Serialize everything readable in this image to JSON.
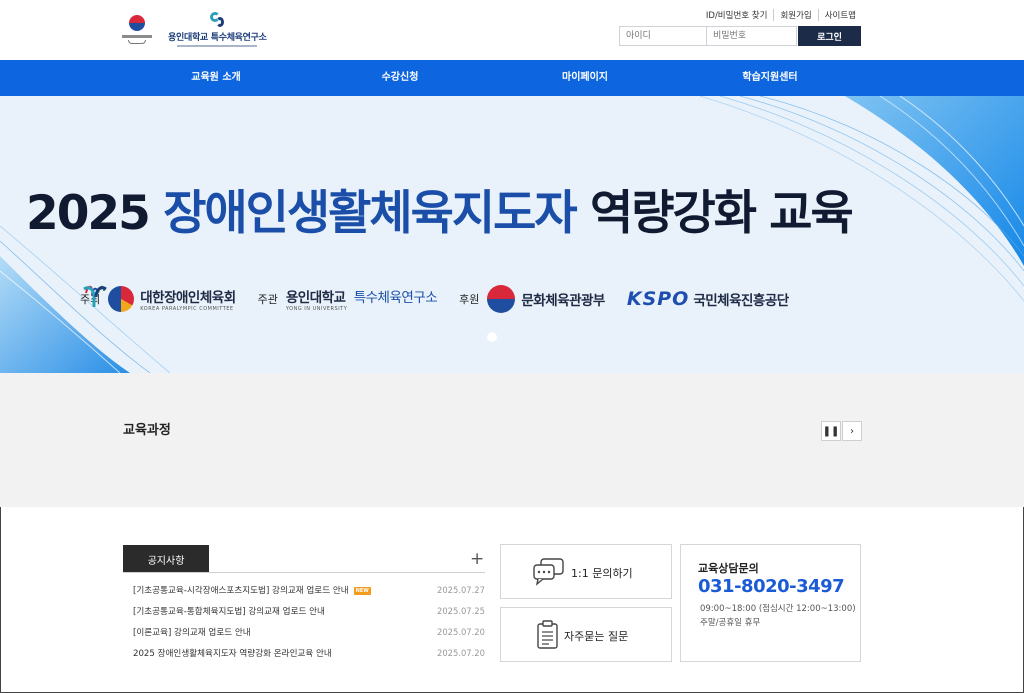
{
  "header": {
    "logo_primary_alt": "대한장애인체육회",
    "logo_secondary": "용인대학교 특수체육연구소",
    "util_links": [
      "ID/비밀번호 찾기",
      "회원가입",
      "사이트맵"
    ],
    "login": {
      "id_placeholder": "아이디",
      "pw_placeholder": "비밀번호",
      "button": "로그인"
    }
  },
  "nav": {
    "items": [
      "교육원 소개",
      "수강신청",
      "마이페이지",
      "학습지원센터"
    ],
    "bg_color": "#0d66e0"
  },
  "banner": {
    "title_year": "2025",
    "title_blue": "장애인생활체육지도자",
    "title_dark": "역량강화 교육",
    "orgs": [
      {
        "role": "주최",
        "name": "대한장애인체육회",
        "sub": "KOREA PARALYMPIC COMMITTEE"
      },
      {
        "role": "주관",
        "name": "용인대학교",
        "name2": "특수체육연구소",
        "sub": "YONG IN UNIVERSITY"
      },
      {
        "role": "후원",
        "name": "문화체육관광부"
      },
      {
        "role": "",
        "name": "KSPO",
        "name2": "국민체육진흥공단"
      }
    ]
  },
  "course": {
    "title": "교육과정",
    "pause_icon": "pause-icon",
    "next_icon": "chevron-right-icon"
  },
  "notice": {
    "tab": "공지사항",
    "more": "+",
    "new_badge": "NEW",
    "items": [
      {
        "title": "[기초공통교육-시각장애스포츠지도법] 강의교재 업로드 안내",
        "date": "2025.07.27",
        "new": true
      },
      {
        "title": "[기초공통교육-통합체육지도법] 강의교재 업로드 안내",
        "date": "2025.07.25",
        "new": false
      },
      {
        "title": "[이론교육] 강의교재 업로드 안내",
        "date": "2025.07.20",
        "new": false
      },
      {
        "title": "2025 장애인생활체육지도자 역량강화 온라인교육 안내",
        "date": "2025.07.20",
        "new": false
      }
    ]
  },
  "quick": {
    "inquiry": "1:1 문의하기",
    "faq": "자주묻는 질문"
  },
  "contact": {
    "title": "교육상담문의",
    "phone": "031-8020-3497",
    "hours": "09:00~18:00 (점심시간 12:00~13:00)",
    "off": "주말/공휴일 휴무"
  }
}
